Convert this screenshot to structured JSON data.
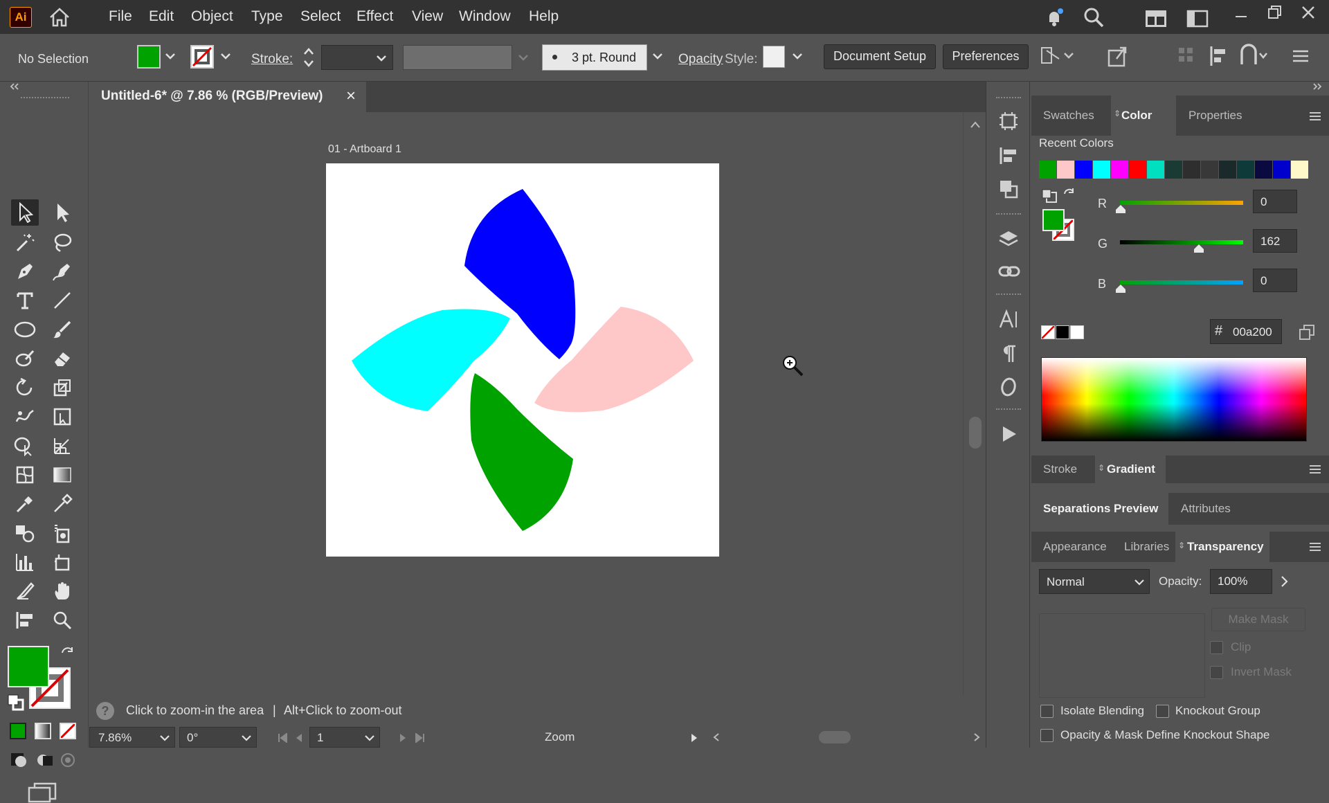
{
  "app": {
    "logo": "Ai"
  },
  "menu": [
    "File",
    "Edit",
    "Object",
    "Type",
    "Select",
    "Effect",
    "View",
    "Window",
    "Help"
  ],
  "control_bar": {
    "selection": "No Selection",
    "stroke_label": "Stroke:",
    "brush": "3 pt. Round",
    "opacity_label": "Opacity",
    "style_label": "Style:",
    "document_setup": "Document Setup",
    "preferences": "Preferences",
    "fill_color": "#00a200"
  },
  "document": {
    "tab_title": "Untitled-6* @ 7.86 % (RGB/Preview)",
    "close": "×",
    "artboard_label": "01 - Artboard 1",
    "shapes": [
      {
        "name": "blue-petal",
        "color": "#0000ff"
      },
      {
        "name": "pink-petal",
        "color": "#ffc8c8"
      },
      {
        "name": "green-petal",
        "color": "#00a200"
      },
      {
        "name": "cyan-petal",
        "color": "#00ffff"
      }
    ]
  },
  "status": {
    "hint": "Click to zoom-in the area",
    "sep": "|",
    "hint2": "Alt+Click to zoom-out",
    "zoom": "7.86%",
    "rotation": "0°",
    "artboard_num": "1",
    "tool": "Zoom"
  },
  "panels": {
    "top_tabs": [
      "Swatches",
      "Color",
      "Properties"
    ],
    "recent_colors_label": "Recent Colors",
    "recent_colors": [
      "#00a200",
      "#ffc8c8",
      "#0000ff",
      "#00ffff",
      "#ff00ff",
      "#ff0000",
      "#00e0c0",
      "#1a3a34",
      "#2e2e2e",
      "#383838",
      "#1a2a2a",
      "#0e3a3a",
      "#0a0a40",
      "#0000cc",
      "#fff8c8"
    ],
    "color": {
      "r_label": "R",
      "r": "0",
      "g_label": "G",
      "g": "162",
      "b_label": "B",
      "b": "0",
      "hash": "#",
      "hex": "00a200"
    },
    "stroke_tabs": [
      "Stroke",
      "Gradient"
    ],
    "sep_tabs": [
      "Separations Preview",
      "Attributes"
    ],
    "trans_tabs": [
      "Appearance",
      "Libraries",
      "Transparency"
    ],
    "transparency": {
      "blend": "Normal",
      "opacity_label": "Opacity:",
      "opacity": "100%",
      "make_mask": "Make Mask",
      "clip": "Clip",
      "invert": "Invert Mask",
      "isolate": "Isolate Blending",
      "knockout": "Knockout Group",
      "define": "Opacity & Mask Define Knockout Shape"
    }
  }
}
